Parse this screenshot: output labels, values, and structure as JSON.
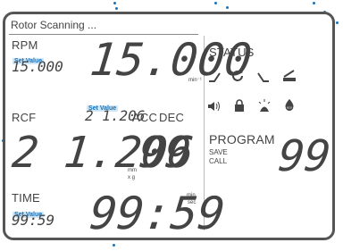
{
  "header": {
    "title": "Rotor Scanning ..."
  },
  "rpm": {
    "label": "RPM",
    "set_value_label": "Set Value",
    "set_value": "15.000",
    "value": "15.000",
    "unit": "min⁻¹"
  },
  "rcf": {
    "label": "RCF",
    "set_value_label": "Set Value",
    "set_value": "2 1.206",
    "value": "2 1.206",
    "unit_top": "mm",
    "unit_bottom": "x g"
  },
  "acc_dec": {
    "acc_label": "ACC",
    "dec_label": "DEC",
    "value": "99"
  },
  "time": {
    "label": "TIME",
    "set_value_label": "Set Value",
    "set_value": "99:59",
    "value": "99:59",
    "unit_top": "min",
    "unit_bottom": "sec"
  },
  "status": {
    "label": "STATUS",
    "icons_row1": [
      "ramp-up-icon",
      "rotation-icon",
      "ramp-down-icon",
      "lid-icon"
    ],
    "icons_row2": [
      "sound-icon",
      "lock-icon",
      "light-icon",
      "eco-icon"
    ]
  },
  "program": {
    "label": "PROGRAM",
    "save_label": "SAVE",
    "call_label": "CALL",
    "value": "99"
  },
  "colors": {
    "frame": "#555555",
    "accent": "#1a72b8",
    "badge_bg": "#cfe6f7",
    "text": "#444444"
  }
}
